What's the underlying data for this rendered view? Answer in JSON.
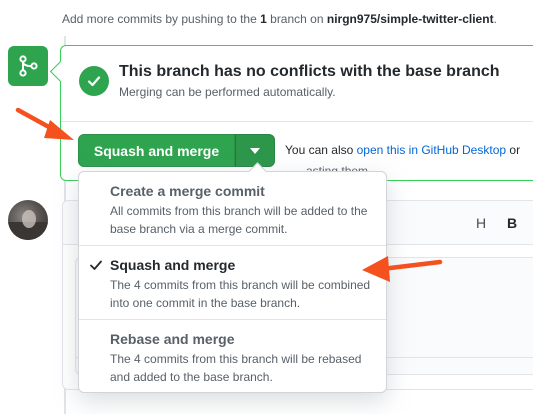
{
  "header": {
    "prefix": "Add more commits by pushing to the",
    "branch_count": "1",
    "mid": "branch on",
    "repo_branch": "nirgn975/simple-twitter-client",
    "suffix": "."
  },
  "merge_status": {
    "title": "This branch has no conflicts with the base branch",
    "subtitle": "Merging can be performed automatically."
  },
  "merge_button": {
    "label": "Squash and merge"
  },
  "alternative": {
    "prefix": "You can also",
    "link_text": "open this in GitHub Desktop",
    "suffix": "or"
  },
  "merge_menu": {
    "selected_index": 1,
    "items": [
      {
        "title": "Create a merge commit",
        "description": "All commits from this branch will be added to the base branch via a merge commit."
      },
      {
        "title": "Squash and merge",
        "description": "The 4 commits from this branch will be combined into one commit in the base branch."
      },
      {
        "title": "Rebase and merge",
        "description": "The 4 commits from this branch will be rebased and added to the base branch."
      }
    ]
  },
  "comment_toolbar": {
    "heading_label": "H",
    "bold_label": "B"
  },
  "comment_hint": "asting them.",
  "colors": {
    "green": "#2ea44f",
    "link_blue": "#0366d6",
    "annotation_red": "#f4511e"
  },
  "icons": {
    "merge_tile": "git-merge-icon",
    "status": "check-circle-icon",
    "caret": "triangle-down-icon",
    "selected": "check-icon"
  }
}
